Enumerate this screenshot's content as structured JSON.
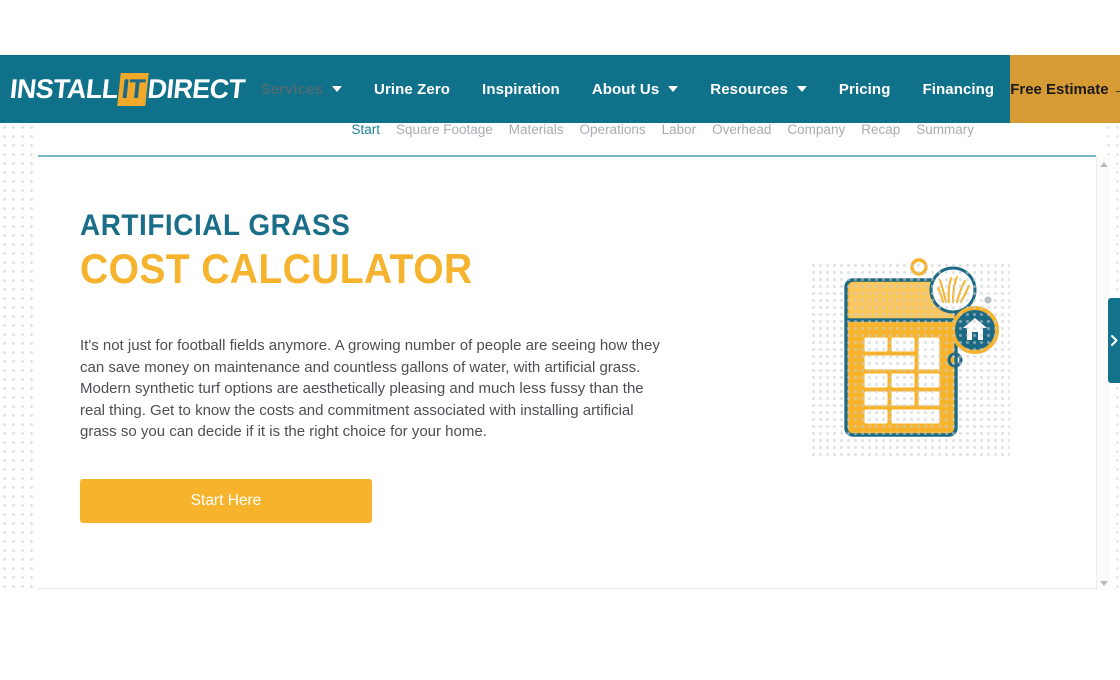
{
  "site": {
    "logo": {
      "part1": "INSTALL",
      "badge": "IT",
      "part2": "DIRECT"
    },
    "nav": [
      {
        "label": "Services",
        "caret": true,
        "state": "dim"
      },
      {
        "label": "Urine Zero",
        "caret": false,
        "state": "normal"
      },
      {
        "label": "Inspiration",
        "caret": false,
        "state": "normal"
      },
      {
        "label": "About Us",
        "caret": true,
        "state": "normal"
      },
      {
        "label": "Resources",
        "caret": true,
        "state": "normal"
      },
      {
        "label": "Pricing",
        "caret": false,
        "state": "normal"
      },
      {
        "label": "Financing",
        "caret": false,
        "state": "normal"
      }
    ],
    "cta_label": "Free Estimate →",
    "search_icon": "search-icon",
    "colors": {
      "header_teal": "#10718a",
      "search_teal": "#0d6278",
      "cta_gold": "#d79b35",
      "heading_teal": "#1b6e88",
      "heading_gold": "#f5b32e",
      "button_gold": "#f7b32b",
      "step_active": "#1b7f96",
      "step_inactive": "#a8adb2",
      "rule_blue": "#79b4c7"
    }
  },
  "calculator": {
    "steps": [
      {
        "label": "Start",
        "active": true
      },
      {
        "label": "Square Footage",
        "active": false
      },
      {
        "label": "Materials",
        "active": false
      },
      {
        "label": "Operations",
        "active": false
      },
      {
        "label": "Labor",
        "active": false
      },
      {
        "label": "Overhead",
        "active": false
      },
      {
        "label": "Company",
        "active": false
      },
      {
        "label": "Recap",
        "active": false
      },
      {
        "label": "Summary",
        "active": false
      }
    ],
    "heading_kicker": "ARTIFICIAL GRASS",
    "heading_main": "COST CALCULATOR",
    "body": "It's not just for football fields anymore. A growing number of people are seeing how they can save money on maintenance and countless gallons of water, with artificial grass. Modern synthetic turf options are aesthetically pleasing and much less fussy than the real thing. Get to know the costs and commitment associated with installing artificial grass so you can decide if it is the right choice for your home.",
    "start_button": "Start Here",
    "illustration": "calculator-with-grass-and-home-badges-illustration"
  },
  "side_tab": {
    "icon": "chevron-right-icon"
  },
  "scrollbar": {
    "up_icon": "scroll-up-arrow-icon",
    "down_icon": "scroll-down-arrow-icon"
  }
}
